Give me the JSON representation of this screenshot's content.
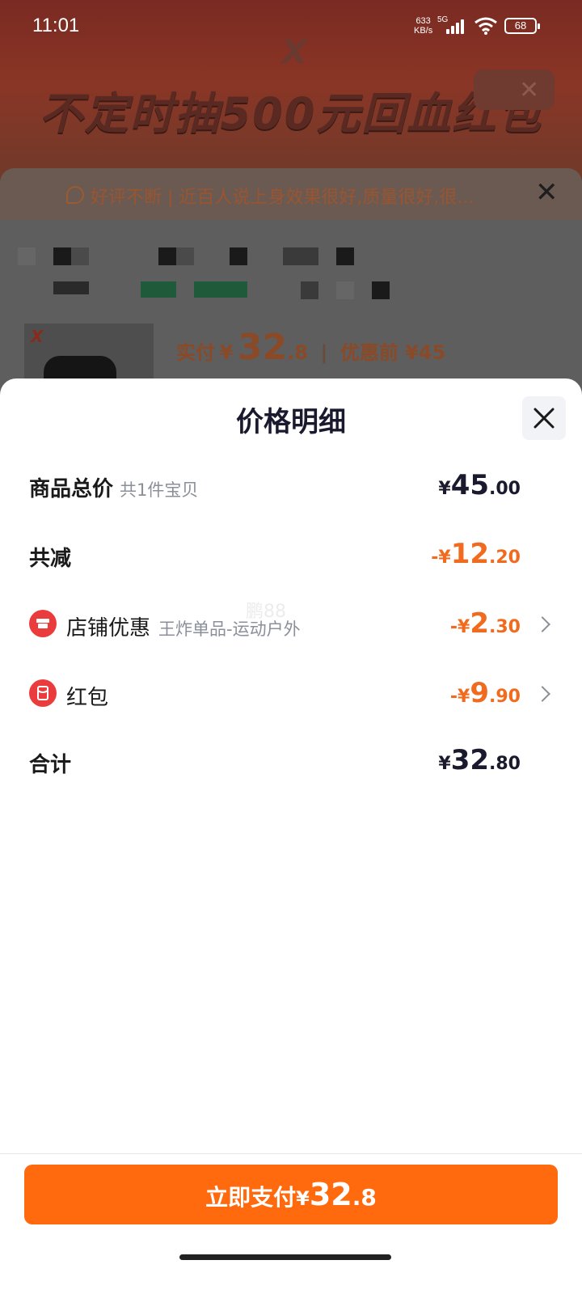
{
  "status_bar": {
    "time": "11:01",
    "net_speed_value": "633",
    "net_speed_unit": "KB/s",
    "network": "5G",
    "battery": "68"
  },
  "background": {
    "banner_text": "不定时抽500元回血红包",
    "review_text": "好评不断 | 近百人说上身效果很好,质量很好,很...",
    "price_label": "实付",
    "price_yen": "¥",
    "price_int": "32",
    "price_dec": ".8",
    "original_price": "优惠前 ¥45"
  },
  "sheet": {
    "title": "价格明细",
    "rows": {
      "subtotal": {
        "label": "商品总价",
        "sub": "共1件宝贝",
        "yen": "¥",
        "int": "45",
        "dec": ".00"
      },
      "discount_total": {
        "label": "共减",
        "yen": "-¥",
        "int": "12",
        "dec": ".20"
      },
      "store_discount": {
        "label": "店铺优惠",
        "sub": "王炸单品-运动户外",
        "yen": "-¥",
        "int": "2",
        "dec": ".30"
      },
      "red_packet": {
        "label": "红包",
        "yen": "-¥",
        "int": "9",
        "dec": ".90"
      },
      "total": {
        "label": "合计",
        "yen": "¥",
        "int": "32",
        "dec": ".80"
      }
    },
    "watermark": "鹏88"
  },
  "pay_button": {
    "label": "立即支付",
    "yen": "¥",
    "int": "32",
    "dec": ".8"
  },
  "colors": {
    "accent_orange": "#ff6a0f",
    "discount_orange": "#f06b1e",
    "red_icon": "#ea3c3c"
  },
  "icons": [
    "speech-bubble-icon",
    "close-icon",
    "store-icon",
    "red-packet-icon",
    "chevron-right-icon",
    "wifi-icon",
    "signal-icon",
    "battery-icon"
  ]
}
